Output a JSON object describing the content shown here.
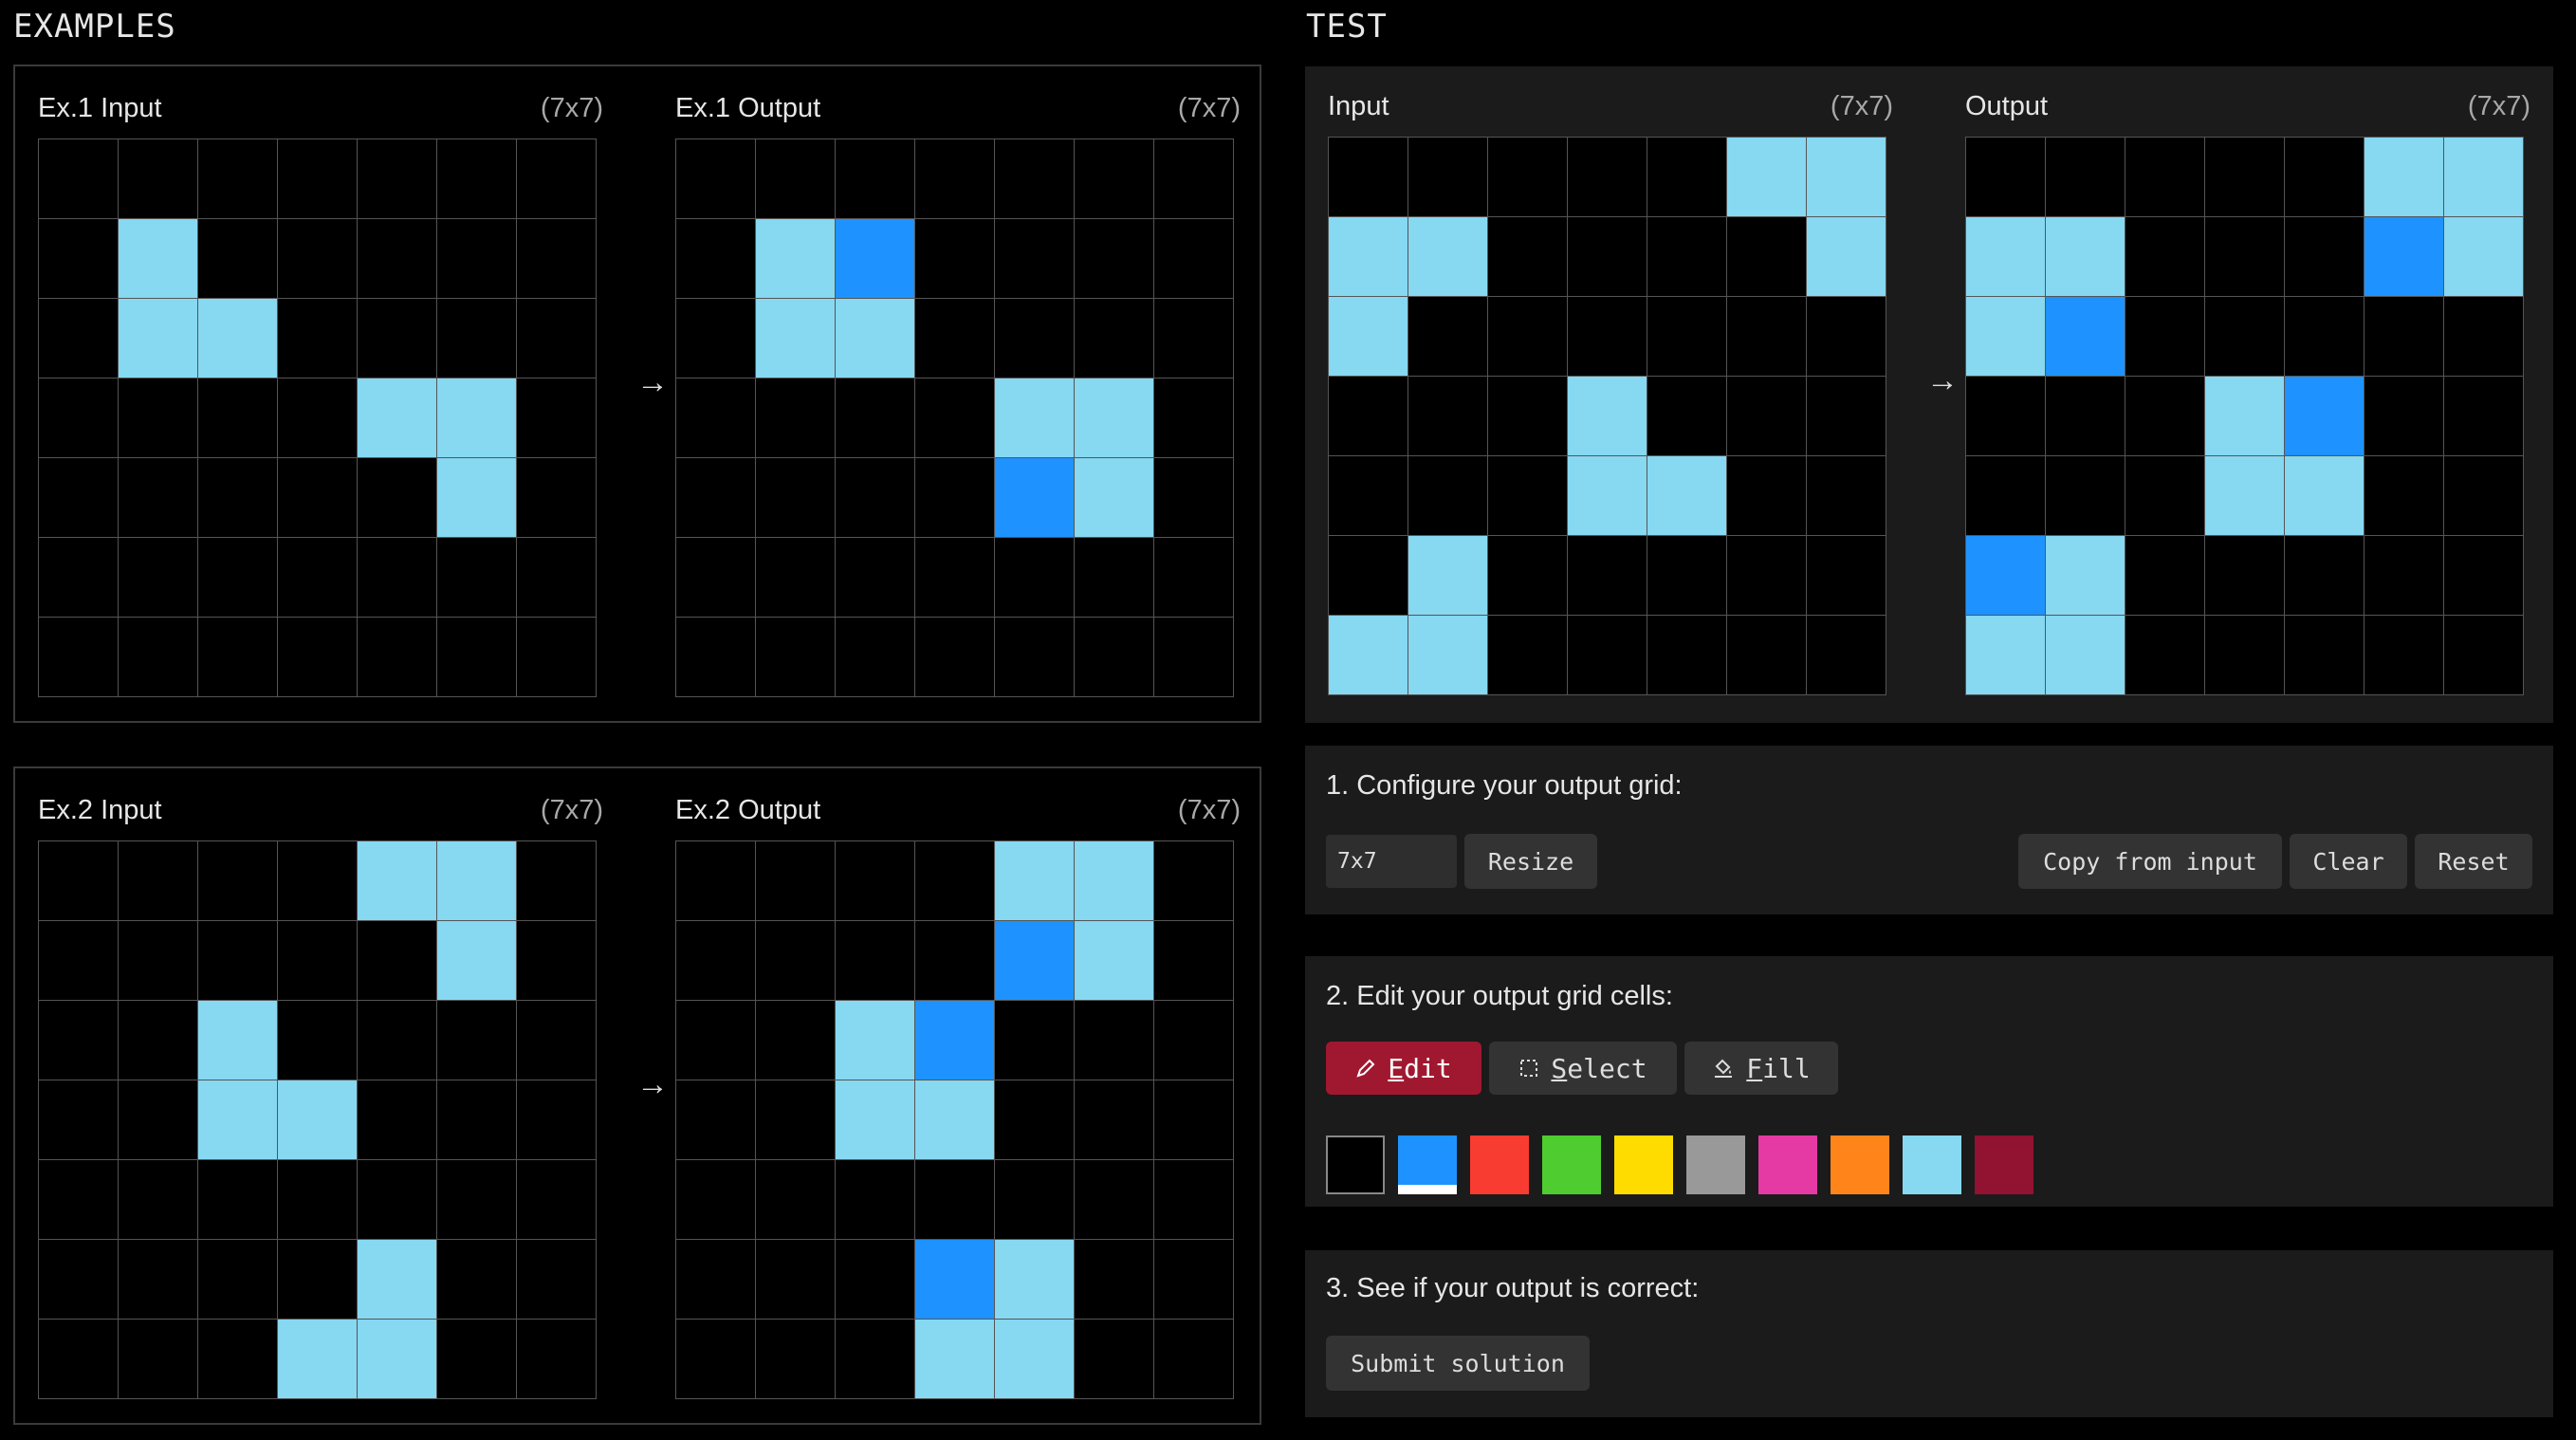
{
  "headings": {
    "examples": "EXAMPLES",
    "test": "TEST"
  },
  "arrow": "→",
  "palette": [
    "#000000",
    "#1e93ff",
    "#f93c31",
    "#4fcc30",
    "#ffdc00",
    "#999999",
    "#e53aa3",
    "#ff851b",
    "#87d8f1",
    "#921231"
  ],
  "examples": [
    {
      "input": {
        "label": "Ex.1 Input",
        "size": "(7x7)",
        "cells": [
          [
            0,
            0,
            0,
            0,
            0,
            0,
            0
          ],
          [
            0,
            8,
            0,
            0,
            0,
            0,
            0
          ],
          [
            0,
            8,
            8,
            0,
            0,
            0,
            0
          ],
          [
            0,
            0,
            0,
            0,
            8,
            8,
            0
          ],
          [
            0,
            0,
            0,
            0,
            0,
            8,
            0
          ],
          [
            0,
            0,
            0,
            0,
            0,
            0,
            0
          ],
          [
            0,
            0,
            0,
            0,
            0,
            0,
            0
          ]
        ]
      },
      "output": {
        "label": "Ex.1 Output",
        "size": "(7x7)",
        "cells": [
          [
            0,
            0,
            0,
            0,
            0,
            0,
            0
          ],
          [
            0,
            8,
            1,
            0,
            0,
            0,
            0
          ],
          [
            0,
            8,
            8,
            0,
            0,
            0,
            0
          ],
          [
            0,
            0,
            0,
            0,
            8,
            8,
            0
          ],
          [
            0,
            0,
            0,
            0,
            1,
            8,
            0
          ],
          [
            0,
            0,
            0,
            0,
            0,
            0,
            0
          ],
          [
            0,
            0,
            0,
            0,
            0,
            0,
            0
          ]
        ]
      }
    },
    {
      "input": {
        "label": "Ex.2 Input",
        "size": "(7x7)",
        "cells": [
          [
            0,
            0,
            0,
            0,
            8,
            8,
            0
          ],
          [
            0,
            0,
            0,
            0,
            0,
            8,
            0
          ],
          [
            0,
            0,
            8,
            0,
            0,
            0,
            0
          ],
          [
            0,
            0,
            8,
            8,
            0,
            0,
            0
          ],
          [
            0,
            0,
            0,
            0,
            0,
            0,
            0
          ],
          [
            0,
            0,
            0,
            0,
            8,
            0,
            0
          ],
          [
            0,
            0,
            0,
            8,
            8,
            0,
            0
          ]
        ]
      },
      "output": {
        "label": "Ex.2 Output",
        "size": "(7x7)",
        "cells": [
          [
            0,
            0,
            0,
            0,
            8,
            8,
            0
          ],
          [
            0,
            0,
            0,
            0,
            1,
            8,
            0
          ],
          [
            0,
            0,
            8,
            1,
            0,
            0,
            0
          ],
          [
            0,
            0,
            8,
            8,
            0,
            0,
            0
          ],
          [
            0,
            0,
            0,
            0,
            0,
            0,
            0
          ],
          [
            0,
            0,
            0,
            1,
            8,
            0,
            0
          ],
          [
            0,
            0,
            0,
            8,
            8,
            0,
            0
          ]
        ]
      }
    }
  ],
  "test": {
    "input": {
      "label": "Input",
      "size": "(7x7)",
      "cells": [
        [
          0,
          0,
          0,
          0,
          0,
          8,
          8
        ],
        [
          8,
          8,
          0,
          0,
          0,
          0,
          8
        ],
        [
          8,
          0,
          0,
          0,
          0,
          0,
          0
        ],
        [
          0,
          0,
          0,
          8,
          0,
          0,
          0
        ],
        [
          0,
          0,
          0,
          8,
          8,
          0,
          0
        ],
        [
          0,
          8,
          0,
          0,
          0,
          0,
          0
        ],
        [
          8,
          8,
          0,
          0,
          0,
          0,
          0
        ]
      ]
    },
    "output": {
      "label": "Output",
      "size": "(7x7)",
      "cells": [
        [
          0,
          0,
          0,
          0,
          0,
          8,
          8
        ],
        [
          8,
          8,
          0,
          0,
          0,
          1,
          8
        ],
        [
          8,
          1,
          0,
          0,
          0,
          0,
          0
        ],
        [
          0,
          0,
          0,
          8,
          1,
          0,
          0
        ],
        [
          0,
          0,
          0,
          8,
          8,
          0,
          0
        ],
        [
          1,
          8,
          0,
          0,
          0,
          0,
          0
        ],
        [
          8,
          8,
          0,
          0,
          0,
          0,
          0
        ]
      ]
    }
  },
  "controls": {
    "step1": "1. Configure your output grid:",
    "size_value": "7x7",
    "resize": "Resize",
    "copy_from_input": "Copy from input",
    "clear": "Clear",
    "reset": "Reset",
    "step2": "2. Edit your output grid cells:",
    "tools": {
      "edit": "Edit",
      "select": "Select",
      "fill": "Fill",
      "active": "edit"
    },
    "selected_color": 1,
    "step3": "3. See if your output is correct:",
    "submit": "Submit solution"
  },
  "icons": {
    "edit": "pencil-icon",
    "select": "dashed-square-icon",
    "fill": "paint-bucket-icon"
  }
}
